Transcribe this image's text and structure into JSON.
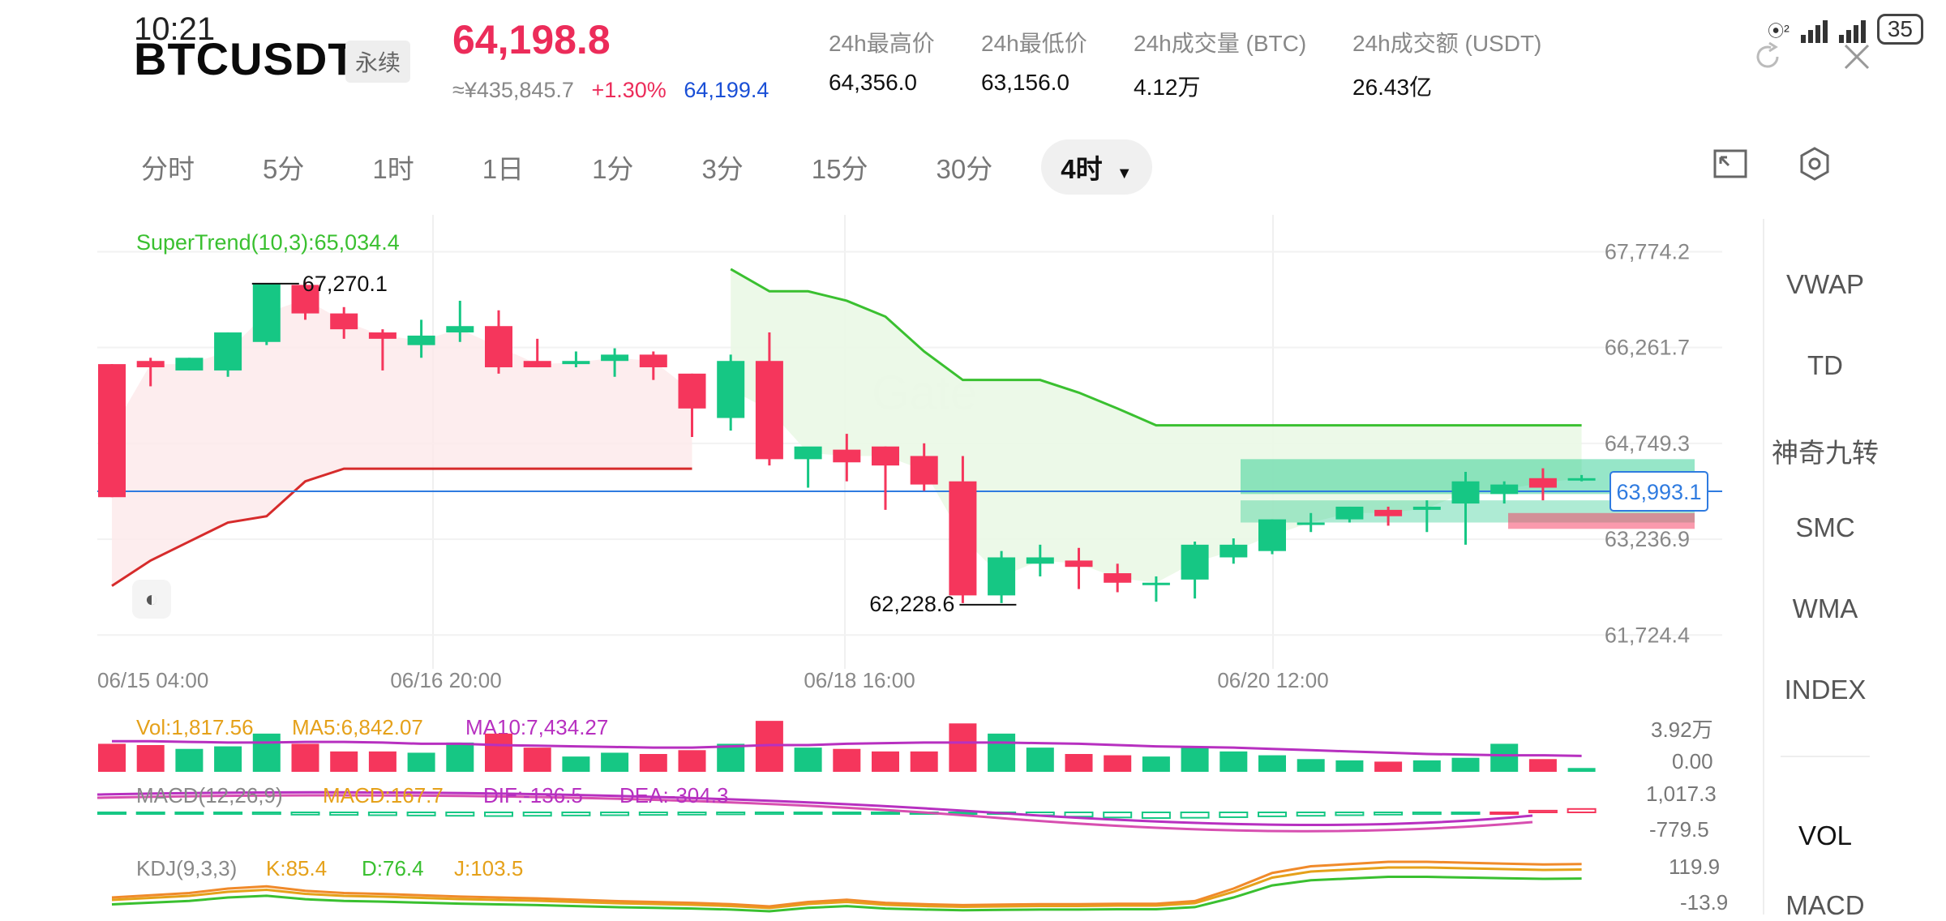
{
  "status_bar": {
    "time": "10:21",
    "battery": "35"
  },
  "header": {
    "symbol": "BTCUSDT",
    "contract_type": "永续",
    "last_price": "64,198.8",
    "cny_price": "≈¥435,845.7",
    "change_pct": "+1.30%",
    "mark_price": "64,199.4",
    "stats": [
      {
        "label": "24h最高价",
        "value": "64,356.0"
      },
      {
        "label": "24h最低价",
        "value": "63,156.0"
      },
      {
        "label": "24h成交量 (BTC)",
        "value": "4.12万"
      },
      {
        "label": "24h成交额 (USDT)",
        "value": "26.43亿"
      }
    ]
  },
  "timeframes": [
    "分时",
    "5分",
    "1时",
    "1日",
    "1分",
    "3分",
    "15分",
    "30分",
    "4时"
  ],
  "active_timeframe": "4时",
  "sidebar": {
    "items": [
      "VWAP",
      "TD",
      "神奇九转",
      "SMC",
      "WMA",
      "INDEX",
      "VOL",
      "MACD"
    ]
  },
  "chart": {
    "watermark": "Gate",
    "supertrend_label": "SuperTrend(10,3):65,034.4",
    "price_ticks": [
      "67,774.2",
      "66,261.7",
      "64,749.3",
      "63,236.9",
      "61,724.4"
    ],
    "current_price_tag": "63,993.1",
    "high_marker": "67,270.1",
    "low_marker": "62,228.6",
    "time_ticks": [
      "06/15 04:00",
      "06/16 20:00",
      "06/18 16:00",
      "06/20 12:00"
    ]
  },
  "volume": {
    "vol": "Vol:1,817.56",
    "ma5": "MA5:6,842.07",
    "ma10": "MA10:7,434.27",
    "axis_top": "3.92万",
    "axis_bottom": "0.00"
  },
  "macd": {
    "title": "MACD(12,26,9)",
    "macd": "MACD:167.7",
    "dif": "DIF:-136.5",
    "dea": "DEA:-304.3",
    "axis_top": "1,017.3",
    "axis_bottom": "-779.5"
  },
  "kdj": {
    "title": "KDJ(9,3,3)",
    "k": "K:85.4",
    "d": "D:76.4",
    "j": "J:103.5",
    "axis_top": "119.9",
    "axis_bottom": "-13.9"
  },
  "colors": {
    "up": "#16c784",
    "down": "#f5365c",
    "accent": "#ec2c5a",
    "supertrend_up": "#3ac030",
    "supertrend_down": "#d62b2b"
  },
  "chart_data": {
    "type": "candlestick",
    "candles": [
      {
        "o": 66000,
        "h": 66000,
        "l": 63900,
        "c": 63900
      },
      {
        "o": 66050,
        "h": 66100,
        "l": 65650,
        "c": 65950
      },
      {
        "o": 65900,
        "h": 66100,
        "l": 65900,
        "c": 66100
      },
      {
        "o": 65900,
        "h": 66500,
        "l": 65800,
        "c": 66500
      },
      {
        "o": 66350,
        "h": 67270.1,
        "l": 66300,
        "c": 67270.1
      },
      {
        "o": 67250,
        "h": 67300,
        "l": 66700,
        "c": 66800
      },
      {
        "o": 66800,
        "h": 66900,
        "l": 66400,
        "c": 66550
      },
      {
        "o": 66500,
        "h": 66550,
        "l": 65900,
        "c": 66400
      },
      {
        "o": 66300,
        "h": 66700,
        "l": 66100,
        "c": 66450
      },
      {
        "o": 66500,
        "h": 67000,
        "l": 66350,
        "c": 66600
      },
      {
        "o": 66600,
        "h": 66850,
        "l": 65850,
        "c": 65950
      },
      {
        "o": 66050,
        "h": 66400,
        "l": 65950,
        "c": 65950
      },
      {
        "o": 66000,
        "h": 66200,
        "l": 65950,
        "c": 66050
      },
      {
        "o": 66050,
        "h": 66250,
        "l": 65800,
        "c": 66150
      },
      {
        "o": 66150,
        "h": 66200,
        "l": 65750,
        "c": 65950
      },
      {
        "o": 65850,
        "h": 65850,
        "l": 64850,
        "c": 65300
      },
      {
        "o": 65150,
        "h": 66150,
        "l": 64950,
        "c": 66050
      },
      {
        "o": 66050,
        "h": 66500,
        "l": 64400,
        "c": 64500
      },
      {
        "o": 64500,
        "h": 64650,
        "l": 64050,
        "c": 64700
      },
      {
        "o": 64650,
        "h": 64900,
        "l": 64150,
        "c": 64450
      },
      {
        "o": 64700,
        "h": 64700,
        "l": 63700,
        "c": 64400
      },
      {
        "o": 64550,
        "h": 64750,
        "l": 64000,
        "c": 64100
      },
      {
        "o": 64150,
        "h": 64550,
        "l": 62228.6,
        "c": 62350
      },
      {
        "o": 62350,
        "h": 63050,
        "l": 62228.6,
        "c": 62950
      },
      {
        "o": 62850,
        "h": 63150,
        "l": 62650,
        "c": 62950
      },
      {
        "o": 62900,
        "h": 63100,
        "l": 62450,
        "c": 62800
      },
      {
        "o": 62700,
        "h": 62850,
        "l": 62400,
        "c": 62550
      },
      {
        "o": 62550,
        "h": 62650,
        "l": 62250,
        "c": 62550
      },
      {
        "o": 62600,
        "h": 63200,
        "l": 62300,
        "c": 63150
      },
      {
        "o": 62950,
        "h": 63250,
        "l": 62850,
        "c": 63150
      },
      {
        "o": 63050,
        "h": 63550,
        "l": 63000,
        "c": 63550
      },
      {
        "o": 63500,
        "h": 63650,
        "l": 63350,
        "c": 63500
      },
      {
        "o": 63550,
        "h": 63750,
        "l": 63500,
        "c": 63750
      },
      {
        "o": 63700,
        "h": 63750,
        "l": 63450,
        "c": 63600
      },
      {
        "o": 63700,
        "h": 63850,
        "l": 63350,
        "c": 63750
      },
      {
        "o": 63800,
        "h": 64300,
        "l": 63150,
        "c": 64150
      },
      {
        "o": 63950,
        "h": 64150,
        "l": 63800,
        "c": 64100
      },
      {
        "o": 64200,
        "h": 64356,
        "l": 63850,
        "c": 64050
      },
      {
        "o": 64200,
        "h": 64250,
        "l": 64150,
        "c": 64200
      }
    ],
    "supertrend_down": [
      null,
      null,
      null,
      null,
      null,
      null,
      null,
      null,
      null,
      null,
      null,
      null,
      null,
      null,
      null,
      null,
      67500,
      67150,
      67150,
      67000,
      66750,
      66200,
      65750,
      65750,
      65750,
      65550,
      65300,
      65034.4,
      65034.4,
      65034.4,
      65034.4,
      65034.4,
      65034.4,
      65034.4,
      65034.4,
      65034.4,
      65034.4,
      65034.4,
      65034.4
    ],
    "supertrend_up": [
      62500,
      62900,
      63200,
      63500,
      63600,
      64150,
      64350,
      64350,
      64350,
      64350,
      64350,
      64350,
      64350,
      64350,
      64350,
      64350,
      null,
      null,
      null,
      null,
      null,
      null,
      null,
      null,
      null,
      null,
      null,
      null,
      null,
      null,
      null,
      null,
      null,
      null,
      null,
      null,
      null,
      null,
      null
    ],
    "last_price_line": 63993.1,
    "y_range": [
      61600,
      68100
    ],
    "volume": [
      2.2,
      2.1,
      1.8,
      2.0,
      3.0,
      2.2,
      1.6,
      1.6,
      1.5,
      2.3,
      3.0,
      1.9,
      1.2,
      1.5,
      1.4,
      1.7,
      2.2,
      4.0,
      1.9,
      1.8,
      1.6,
      1.6,
      3.8,
      3.0,
      1.9,
      1.4,
      1.3,
      1.2,
      2.0,
      1.6,
      1.3,
      1.0,
      0.9,
      0.8,
      0.9,
      1.1,
      2.2,
      1.0,
      0.3
    ],
    "volume_ma10": [
      2.4,
      2.4,
      2.35,
      2.3,
      2.3,
      2.35,
      2.35,
      2.3,
      2.2,
      2.2,
      2.1,
      2.05,
      2.0,
      1.95,
      1.9,
      1.9,
      2.0,
      2.1,
      2.1,
      2.2,
      2.25,
      2.3,
      2.3,
      2.3,
      2.25,
      2.2,
      2.1,
      2.0,
      1.95,
      1.9,
      1.8,
      1.7,
      1.6,
      1.5,
      1.4,
      1.35,
      1.3,
      1.3,
      1.25
    ],
    "macd_hist": [
      -20,
      -30,
      -40,
      -50,
      -60,
      -80,
      -90,
      -100,
      -110,
      -120,
      -130,
      -120,
      -110,
      -100,
      -90,
      -80,
      -70,
      -60,
      -50,
      -40,
      -30,
      -20,
      -10,
      -50,
      -100,
      -150,
      -180,
      -200,
      -190,
      -170,
      -140,
      -120,
      -100,
      -80,
      -60,
      -30,
      0,
      60,
      120
    ],
    "kdj_k": [
      20,
      25,
      30,
      40,
      45,
      35,
      30,
      28,
      25,
      22,
      20,
      18,
      15,
      12,
      10,
      8,
      5,
      0,
      10,
      15,
      8,
      5,
      3,
      4,
      5,
      5,
      6,
      6,
      12,
      40,
      75,
      90,
      95,
      100,
      100,
      98,
      96,
      94,
      95
    ]
  }
}
